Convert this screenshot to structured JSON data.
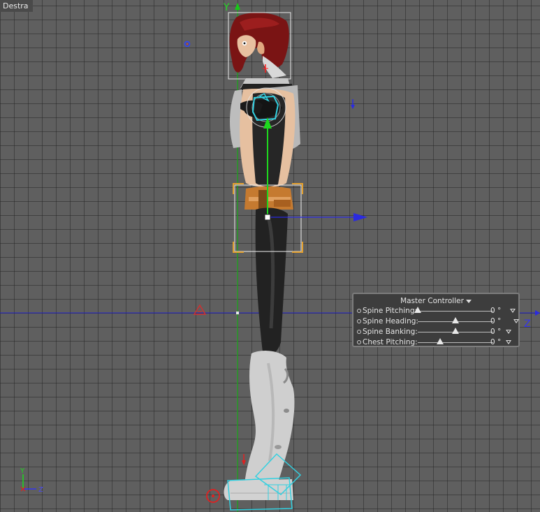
{
  "viewport": {
    "title": "Destra"
  },
  "axes": {
    "vertical_label": "Y",
    "horizontal_label": "Z",
    "gizmo_y": "Y",
    "gizmo_z": "Z"
  },
  "colors": {
    "grid_bg": "#5f5f5f",
    "axis_green": "#16c516",
    "axis_blue": "#2222cc",
    "selection_cyan": "#33d0e0",
    "bbox_orange": "#e2a030",
    "hair_red": "#7a1414"
  },
  "master_controller": {
    "title": "Master Controller",
    "controls": [
      {
        "label": "Spine Pitching:",
        "value": "0 °",
        "level": 0.0
      },
      {
        "label": "Spine Heading:",
        "value": "0 °",
        "level": 0.5
      },
      {
        "label": "Spine Banking:",
        "value": "0 °",
        "level": 0.5
      },
      {
        "label": "Chest Pitching:",
        "value": "0 °",
        "level": 0.3
      }
    ]
  }
}
